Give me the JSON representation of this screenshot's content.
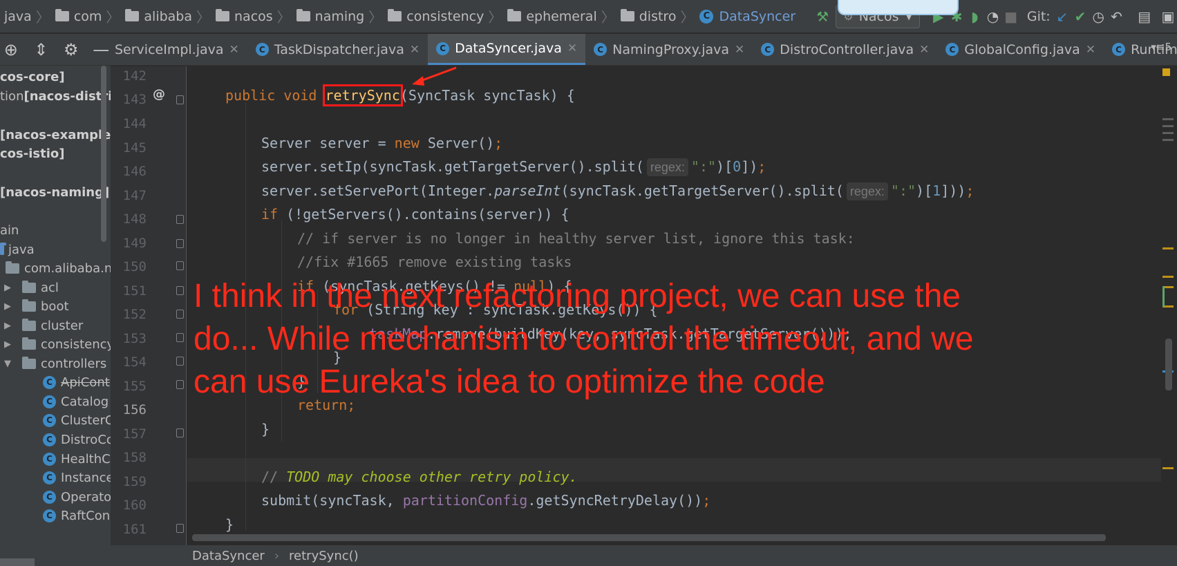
{
  "breadcrumbs": [
    "java",
    "com",
    "alibaba",
    "nacos",
    "naming",
    "consistency",
    "ephemeral",
    "distro"
  ],
  "current_class": "DataSyncer",
  "run_config": "Nacos",
  "git_label": "Git:",
  "tabs": [
    {
      "label": "ServiceImpl.java",
      "active": false
    },
    {
      "label": "TaskDispatcher.java",
      "active": false
    },
    {
      "label": "DataSyncer.java",
      "active": true
    },
    {
      "label": "NamingProxy.java",
      "active": false
    },
    {
      "label": "DistroController.java",
      "active": false
    },
    {
      "label": "GlobalConfig.java",
      "active": false
    },
    {
      "label": "Runtime.ja",
      "active": false
    }
  ],
  "tab_overflow": "5",
  "project_tree": [
    {
      "text": "cos-core]",
      "style": "module"
    },
    {
      "prefix": "tion ",
      "text": "[nacos-distrib",
      "style": "module"
    },
    {
      "text": "[nacos-example]",
      "style": "module"
    },
    {
      "text": "cos-istio]",
      "style": "module"
    },
    {
      "text": "[nacos-naming]",
      "style": "module"
    },
    {
      "text": "ain",
      "style": "plain"
    },
    {
      "text": "java",
      "style": "src"
    },
    {
      "text": "com.alibaba.na",
      "style": "package"
    },
    {
      "text": "acl",
      "style": "folder"
    },
    {
      "text": "boot",
      "style": "folder"
    },
    {
      "text": "cluster",
      "style": "folder"
    },
    {
      "text": "consistency",
      "style": "folder"
    },
    {
      "text": "controllers",
      "style": "folder-open"
    },
    {
      "text": "ApiCont",
      "style": "class-deprecated"
    },
    {
      "text": "Catalog",
      "style": "class"
    },
    {
      "text": "ClusterC",
      "style": "class"
    },
    {
      "text": "DistroCo",
      "style": "class"
    },
    {
      "text": "HealthC",
      "style": "class"
    },
    {
      "text": "Instance",
      "style": "class"
    },
    {
      "text": "Operato",
      "style": "class"
    },
    {
      "text": "RaftCon",
      "style": "class"
    }
  ],
  "line_numbers": [
    "142",
    "143",
    "144",
    "145",
    "146",
    "147",
    "148",
    "149",
    "150",
    "151",
    "152",
    "153",
    "154",
    "155",
    "156",
    "157",
    "158",
    "159",
    "160",
    "161"
  ],
  "current_line": "156",
  "code": {
    "l143_mod": "public void ",
    "l143_method": "retrySync",
    "l143_rest": "(SyncTask syncTask) {",
    "l145_a": "Server server = ",
    "l145_new": "new",
    "l145_b": " Server()",
    "l146_a": "server.setIp(syncTask.getTargetServer().split(",
    "l146_hint": "regex:",
    "l146_str": "\":\"",
    "l146_b": ")[",
    "l146_num": "0",
    "l146_c": "])",
    "l147_a": "server.setServePort(Integer.",
    "l147_it": "parseInt",
    "l147_b": "(syncTask.getTargetServer().split(",
    "l147_hint": "regex:",
    "l147_str": "\":\"",
    "l147_c": ")[",
    "l147_num": "1",
    "l147_d": "]))",
    "l148_if": "if",
    "l148_rest": " (!getServers().contains(server)) {",
    "l149": "// if server is no longer in healthy server list, ignore this task:",
    "l150": "//fix #1665 remove existing tasks",
    "l151_if": "if",
    "l151_a": " (syncTask.getKeys() != ",
    "l151_null": "null",
    "l151_b": ") {",
    "l152_for": "for",
    "l152_rest": " (String key : syncTask.getKeys()) {",
    "l153_fld": "taskMap",
    "l153_rest": ".remove(buildKey(key, syncTask.getTargetServer()));",
    "l154": "}",
    "l155": "}",
    "l156": "return;",
    "l157": "}",
    "l159_slash": "// ",
    "l159_todo": "TODO may choose other retry policy.",
    "l160_a": "submit(syncTask, ",
    "l160_fld": "partitionConfig",
    "l160_b": ".getSyncRetryDelay())",
    "semicolon": ";",
    "l161": "}"
  },
  "status_breadcrumb": [
    "DataSyncer",
    "retrySync()"
  ],
  "annotation": "I think in the next refactoring project, we can use the do... While mechanism to control the timeout, and we can use Eureka's idea to optimize the code",
  "icons": {
    "build": "hammer-icon",
    "run": "run-icon",
    "debug": "debug-icon",
    "coverage": "coverage-icon",
    "profile": "profile-icon",
    "stop": "stop-icon",
    "git_update": "git-update-icon",
    "git_commit": "git-commit-icon",
    "history": "history-icon",
    "rollback": "rollback-icon"
  },
  "colors": {
    "keyword": "#cc7832",
    "comment": "#808080",
    "todo": "#a8c023",
    "number": "#6897bb",
    "string": "#6a8759",
    "field": "#9876aa",
    "annotation": "#ff2a1a",
    "tab_underline": "#4a88c7"
  }
}
